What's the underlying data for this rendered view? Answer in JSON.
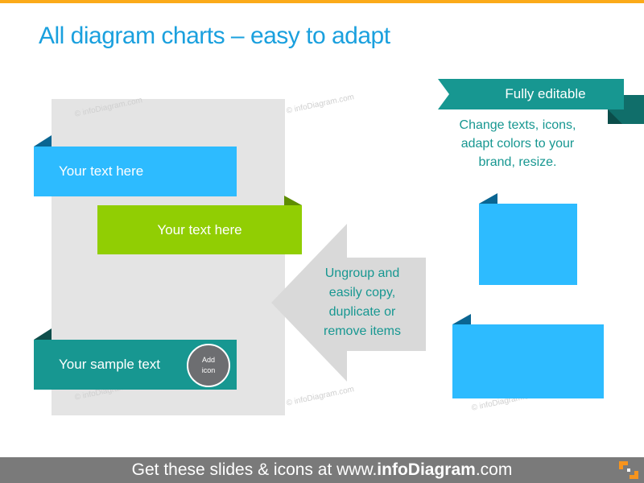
{
  "slide": {
    "title": "All diagram charts – easy to adapt",
    "accent_color": "#FBAA19",
    "title_color": "#1AA0DE"
  },
  "watermark": "© infoDiagram.com",
  "left_diagram": {
    "ribbons": [
      {
        "label": "Your text here",
        "color": "#2DBBFF"
      },
      {
        "label": "Your text here",
        "color": "#91CE03"
      },
      {
        "label": "Your sample text",
        "color": "#179791"
      }
    ],
    "icon_placeholder": {
      "line1": "Add",
      "line2": "icon"
    }
  },
  "arrow_callout": {
    "lines": [
      "Ungroup and",
      "easily copy,",
      "duplicate or",
      "remove items"
    ]
  },
  "editable_callout": {
    "ribbon_label": "Fully editable",
    "lines": [
      "Change texts, icons,",
      "adapt colors to your",
      "brand, resize."
    ]
  },
  "blank_boxes": [
    {
      "color": "#2DBBFF"
    },
    {
      "color": "#2DBBFF"
    }
  ],
  "footer": {
    "prefix": "Get these slides & icons at www.",
    "brand": "infoDiagram",
    "suffix": ".com"
  }
}
